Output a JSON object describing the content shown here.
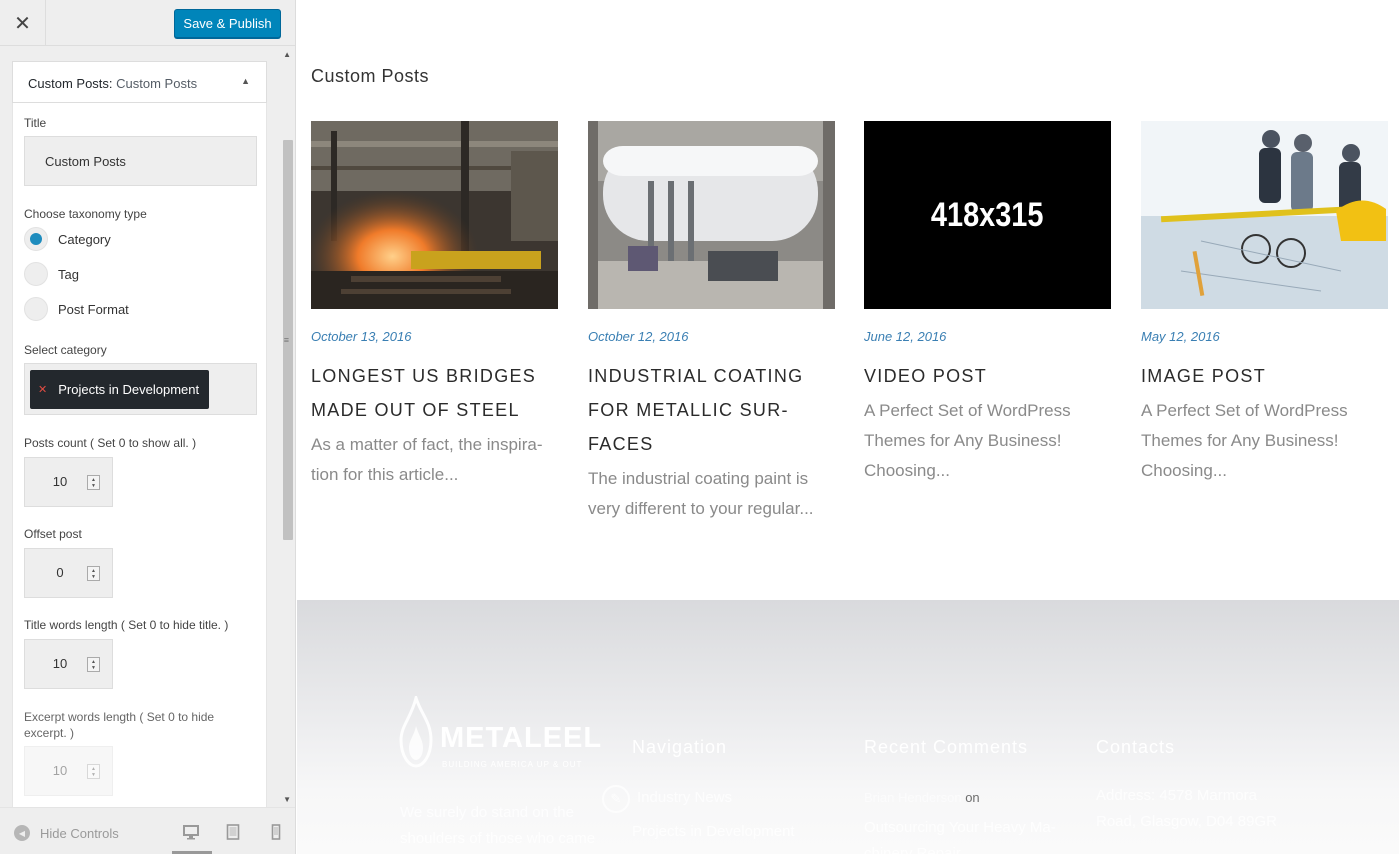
{
  "topbar": {
    "close_glyph": "✕",
    "publish_label": "Save & Publish"
  },
  "widget": {
    "header_prefix": "Custom Posts:",
    "header_name": "Custom Posts",
    "title_label": "Title",
    "title_value": "Custom Posts",
    "taxonomy_label": "Choose taxonomy type",
    "taxonomy_options": [
      "Category",
      "Tag",
      "Post Format"
    ],
    "taxonomy_selected": "Category",
    "category_label": "Select category",
    "category_chip": "Projects in Development",
    "posts_count_label": "Posts count ( Set 0 to show all. )",
    "posts_count": "10",
    "offset_label": "Offset post",
    "offset": "0",
    "title_words_label": "Title words length ( Set 0 to hide title. )",
    "title_words": "10",
    "excerpt_words_label": "Excerpt words length ( Set 0 to hide excerpt. )",
    "excerpt_words": "10"
  },
  "bottombar": {
    "hide_controls": "Hide Controls"
  },
  "preview": {
    "block_title": "Custom Posts",
    "posts": [
      {
        "date": "October 13, 2016",
        "title": "LONGEST US BRIDGES MADE OUT OF STEEL",
        "excerpt": "As a matter of fact, the inspira-tion for this article..."
      },
      {
        "date": "October 12, 2016",
        "title": "INDUSTRIAL COATING FOR METALLIC SUR-FACES",
        "excerpt": "The industrial coating paint is very different to your regular..."
      },
      {
        "date": "June 12, 2016",
        "title": "VIDEO POST",
        "excerpt": "A Perfect Set of WordPress Themes for Any Business! Choosing..."
      },
      {
        "date": "May 12, 2016",
        "title": "IMAGE POST",
        "excerpt": "A Perfect Set of WordPress Themes for Any Business! Choosing..."
      }
    ],
    "placeholder_text": "418x315"
  },
  "footer": {
    "logo_text": "METALEEL",
    "logo_tagline": "BUILDING AMERICA UP & OUT",
    "about_text": "We surely do stand on the shoulders of those who came",
    "nav_title": "Navigation",
    "nav_items": [
      "Industry News",
      "Projects in Development"
    ],
    "comments_title": "Recent Comments",
    "comment_author": "Brian Henderson",
    "comment_on": "on",
    "comment_post": "Outsourcing Your Heavy Ma-chinery Repair",
    "contacts_title": "Contacts",
    "contacts_address": "Address: 4578 Marmora Road, Glasgow, D04 89GR"
  },
  "colors": {
    "accent": "#0085ba",
    "date_blue": "#3a7fb3",
    "chip_bg": "#23282d",
    "radio_selected": "#1e8cbe"
  }
}
